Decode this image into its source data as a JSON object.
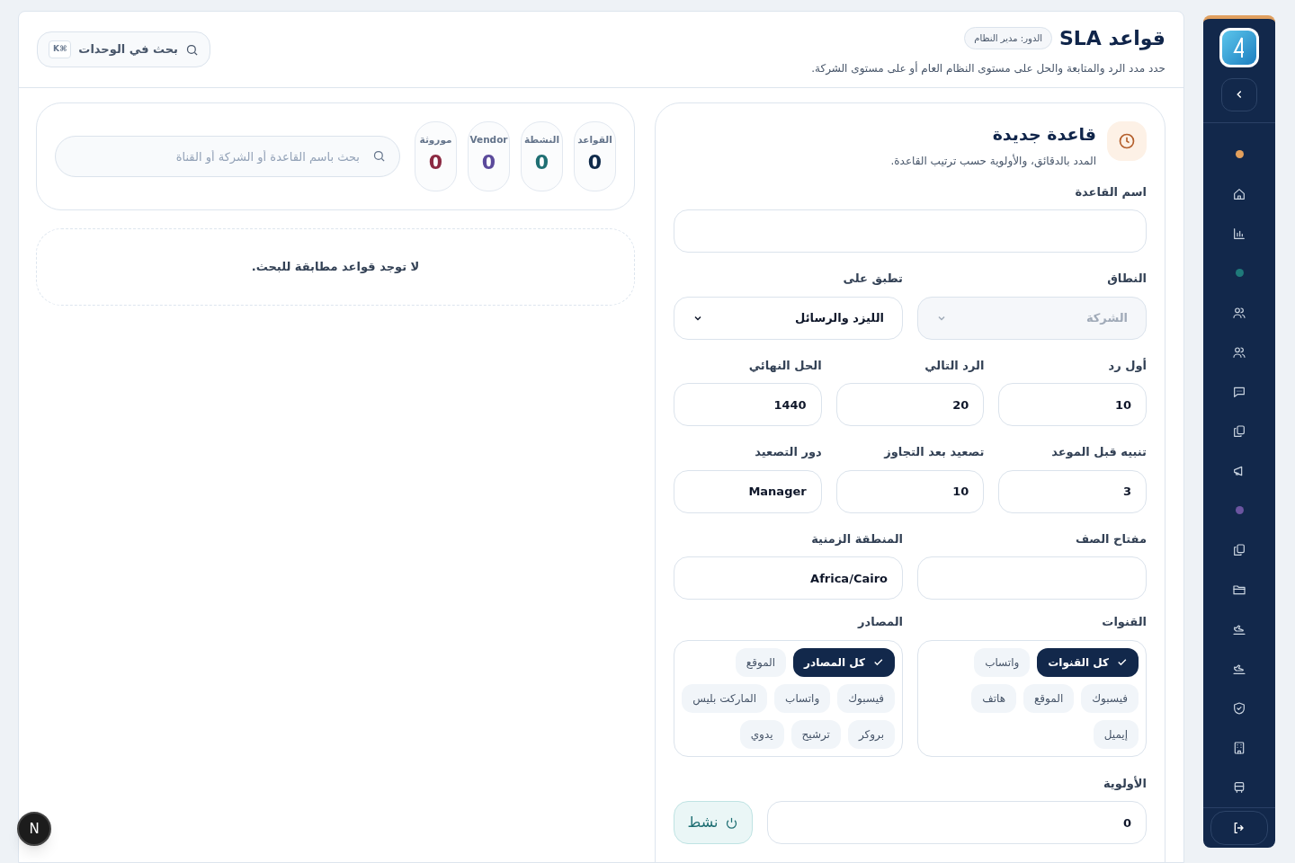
{
  "sidebar": {
    "items": [
      {
        "kind": "dot",
        "color": "#e3a05c"
      },
      {
        "kind": "icon"
      },
      {
        "kind": "icon"
      },
      {
        "kind": "dot",
        "color": "#1f7a7a"
      },
      {
        "kind": "icon"
      },
      {
        "kind": "icon"
      },
      {
        "kind": "icon"
      },
      {
        "kind": "icon"
      },
      {
        "kind": "icon"
      },
      {
        "kind": "dot",
        "color": "#6b55a0"
      },
      {
        "kind": "icon"
      },
      {
        "kind": "icon"
      },
      {
        "kind": "icon"
      },
      {
        "kind": "icon"
      },
      {
        "kind": "icon"
      },
      {
        "kind": "icon"
      },
      {
        "kind": "icon"
      }
    ]
  },
  "header": {
    "title": "قواعد SLA",
    "role_badge": "الدور: مدير النظام",
    "subtitle": "حدد مدد الرد والمتابعة والحل على مستوى النظام العام أو على مستوى الشركة.",
    "search": {
      "label": "بحث في الوحدات",
      "shortcut": "K⌘"
    }
  },
  "form": {
    "title": "قاعدة جديدة",
    "subtitle": "المدد بالدقائق، والأولوية حسب ترتيب القاعدة.",
    "rows": [
      [
        {
          "kind": "input",
          "label": "اسم القاعدة"
        }
      ],
      [
        {
          "kind": "select",
          "label": "النطاق",
          "value": "الشركة",
          "disabled": true
        },
        {
          "kind": "select",
          "label": "تطبق على",
          "value": "الليزد والرسائل",
          "disabled": false
        }
      ],
      [
        {
          "kind": "input",
          "label": "أول رد",
          "value": "10"
        },
        {
          "kind": "input",
          "label": "الرد التالي",
          "value": "20"
        },
        {
          "kind": "input",
          "label": "الحل النهائي",
          "value": "1440"
        }
      ],
      [
        {
          "kind": "input",
          "label": "تنبيه قبل الموعد",
          "value": "3"
        },
        {
          "kind": "input",
          "label": "تصعيد بعد التجاوز",
          "value": "10"
        },
        {
          "kind": "input",
          "label": "دور التصعيد",
          "value": "Manager"
        }
      ],
      [
        {
          "kind": "input",
          "label": "مفتاح الصف"
        },
        {
          "kind": "input",
          "label": "المنطقة الزمنية",
          "value": "Africa/Cairo"
        }
      ]
    ],
    "chip_groups": [
      {
        "label": "القنوات",
        "chips": [
          {
            "label": "كل القنوات",
            "selected": true
          },
          {
            "label": "واتساب",
            "selected": false
          },
          {
            "label": "فيسبوك",
            "selected": false
          },
          {
            "label": "الموقع",
            "selected": false
          },
          {
            "label": "هاتف",
            "selected": false
          },
          {
            "label": "إيميل",
            "selected": false
          }
        ]
      },
      {
        "label": "المصادر",
        "chips": [
          {
            "label": "كل المصادر",
            "selected": true
          },
          {
            "label": "الموقع",
            "selected": false
          },
          {
            "label": "فيسبوك",
            "selected": false
          },
          {
            "label": "واتساب",
            "selected": false
          },
          {
            "label": "الماركت بليس",
            "selected": false
          },
          {
            "label": "بروكر",
            "selected": false
          },
          {
            "label": "ترشيح",
            "selected": false
          },
          {
            "label": "يدوي",
            "selected": false
          }
        ]
      }
    ],
    "priority": {
      "label": "الأولوية",
      "value": "0"
    },
    "active_toggle": {
      "label": "نشط",
      "on": true
    }
  },
  "stats": [
    {
      "label": "القواعد",
      "value": "0",
      "color": "#0f2a4a"
    },
    {
      "label": "النشطة",
      "value": "0",
      "color": "#1f6f73"
    },
    {
      "label": "Vendor",
      "value": "0",
      "color": "#5b4a9b"
    },
    {
      "label": "موروثة",
      "value": "0",
      "color": "#8b2942"
    }
  ],
  "list_search": {
    "placeholder": "بحث باسم القاعدة أو الشركة أو القناة"
  },
  "empty_message": "لا توجد قواعد مطابقة للبحث.",
  "dev_badge": "N"
}
